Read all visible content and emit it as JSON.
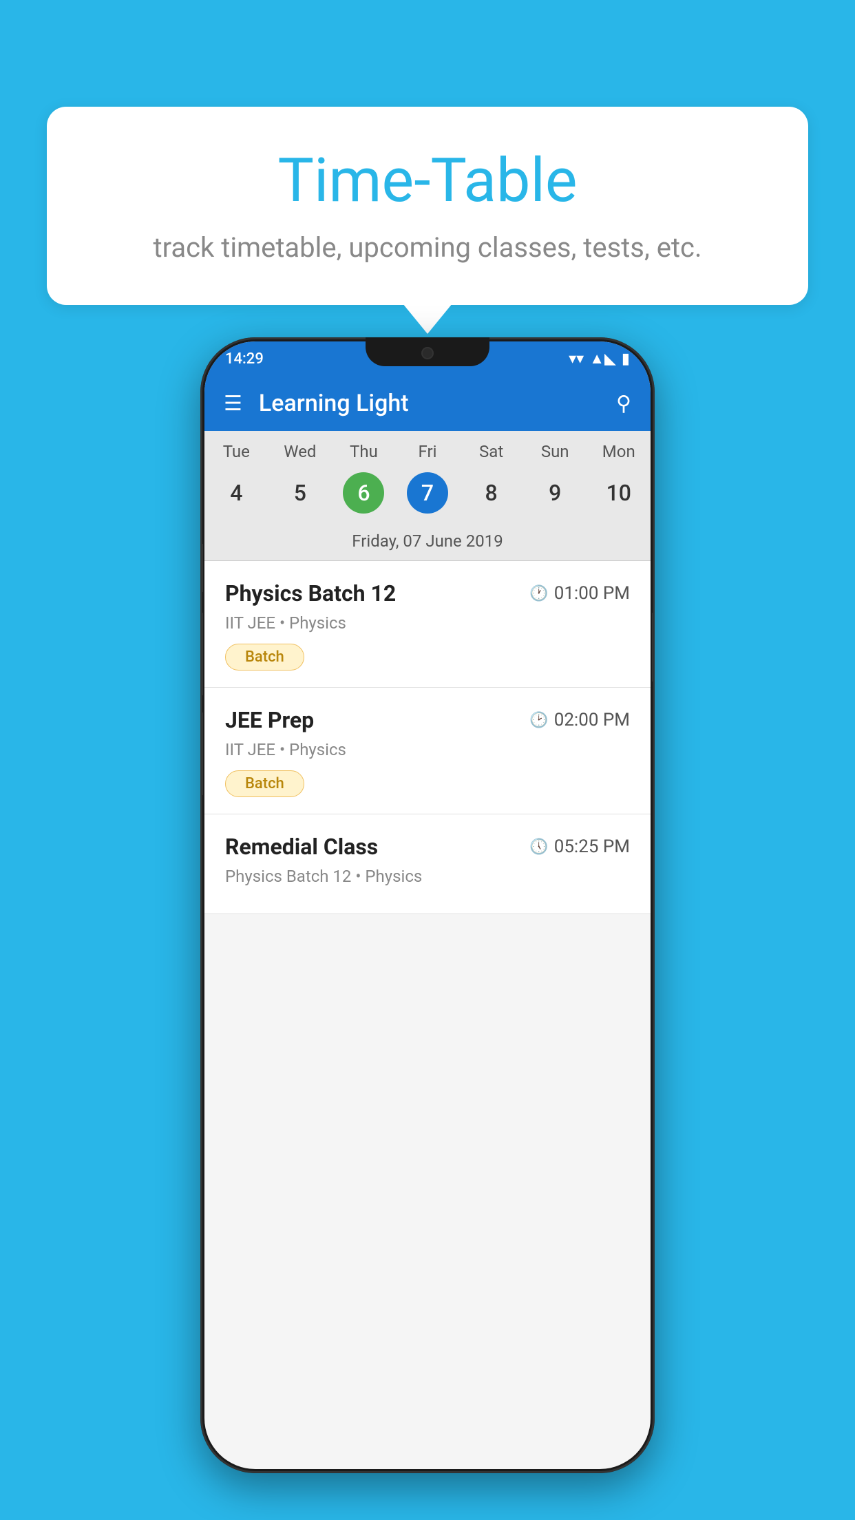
{
  "background_color": "#29b6e8",
  "speech_bubble": {
    "title": "Time-Table",
    "subtitle": "track timetable, upcoming classes, tests, etc."
  },
  "phone": {
    "status_bar": {
      "time": "14:29",
      "wifi": "▼",
      "signal": "◣",
      "battery": "▮"
    },
    "app_bar": {
      "title": "Learning Light",
      "menu_label": "menu",
      "search_label": "search"
    },
    "calendar": {
      "days": [
        "Tue",
        "Wed",
        "Thu",
        "Fri",
        "Sat",
        "Sun",
        "Mon"
      ],
      "dates": [
        "4",
        "5",
        "6",
        "7",
        "8",
        "9",
        "10"
      ],
      "today_index": 2,
      "selected_index": 3,
      "selected_date_label": "Friday, 07 June 2019"
    },
    "classes": [
      {
        "name": "Physics Batch 12",
        "time": "01:00 PM",
        "subtitle": "IIT JEE • Physics",
        "tag": "Batch"
      },
      {
        "name": "JEE Prep",
        "time": "02:00 PM",
        "subtitle": "IIT JEE • Physics",
        "tag": "Batch"
      },
      {
        "name": "Remedial Class",
        "time": "05:25 PM",
        "subtitle": "Physics Batch 12 • Physics",
        "tag": ""
      }
    ]
  }
}
